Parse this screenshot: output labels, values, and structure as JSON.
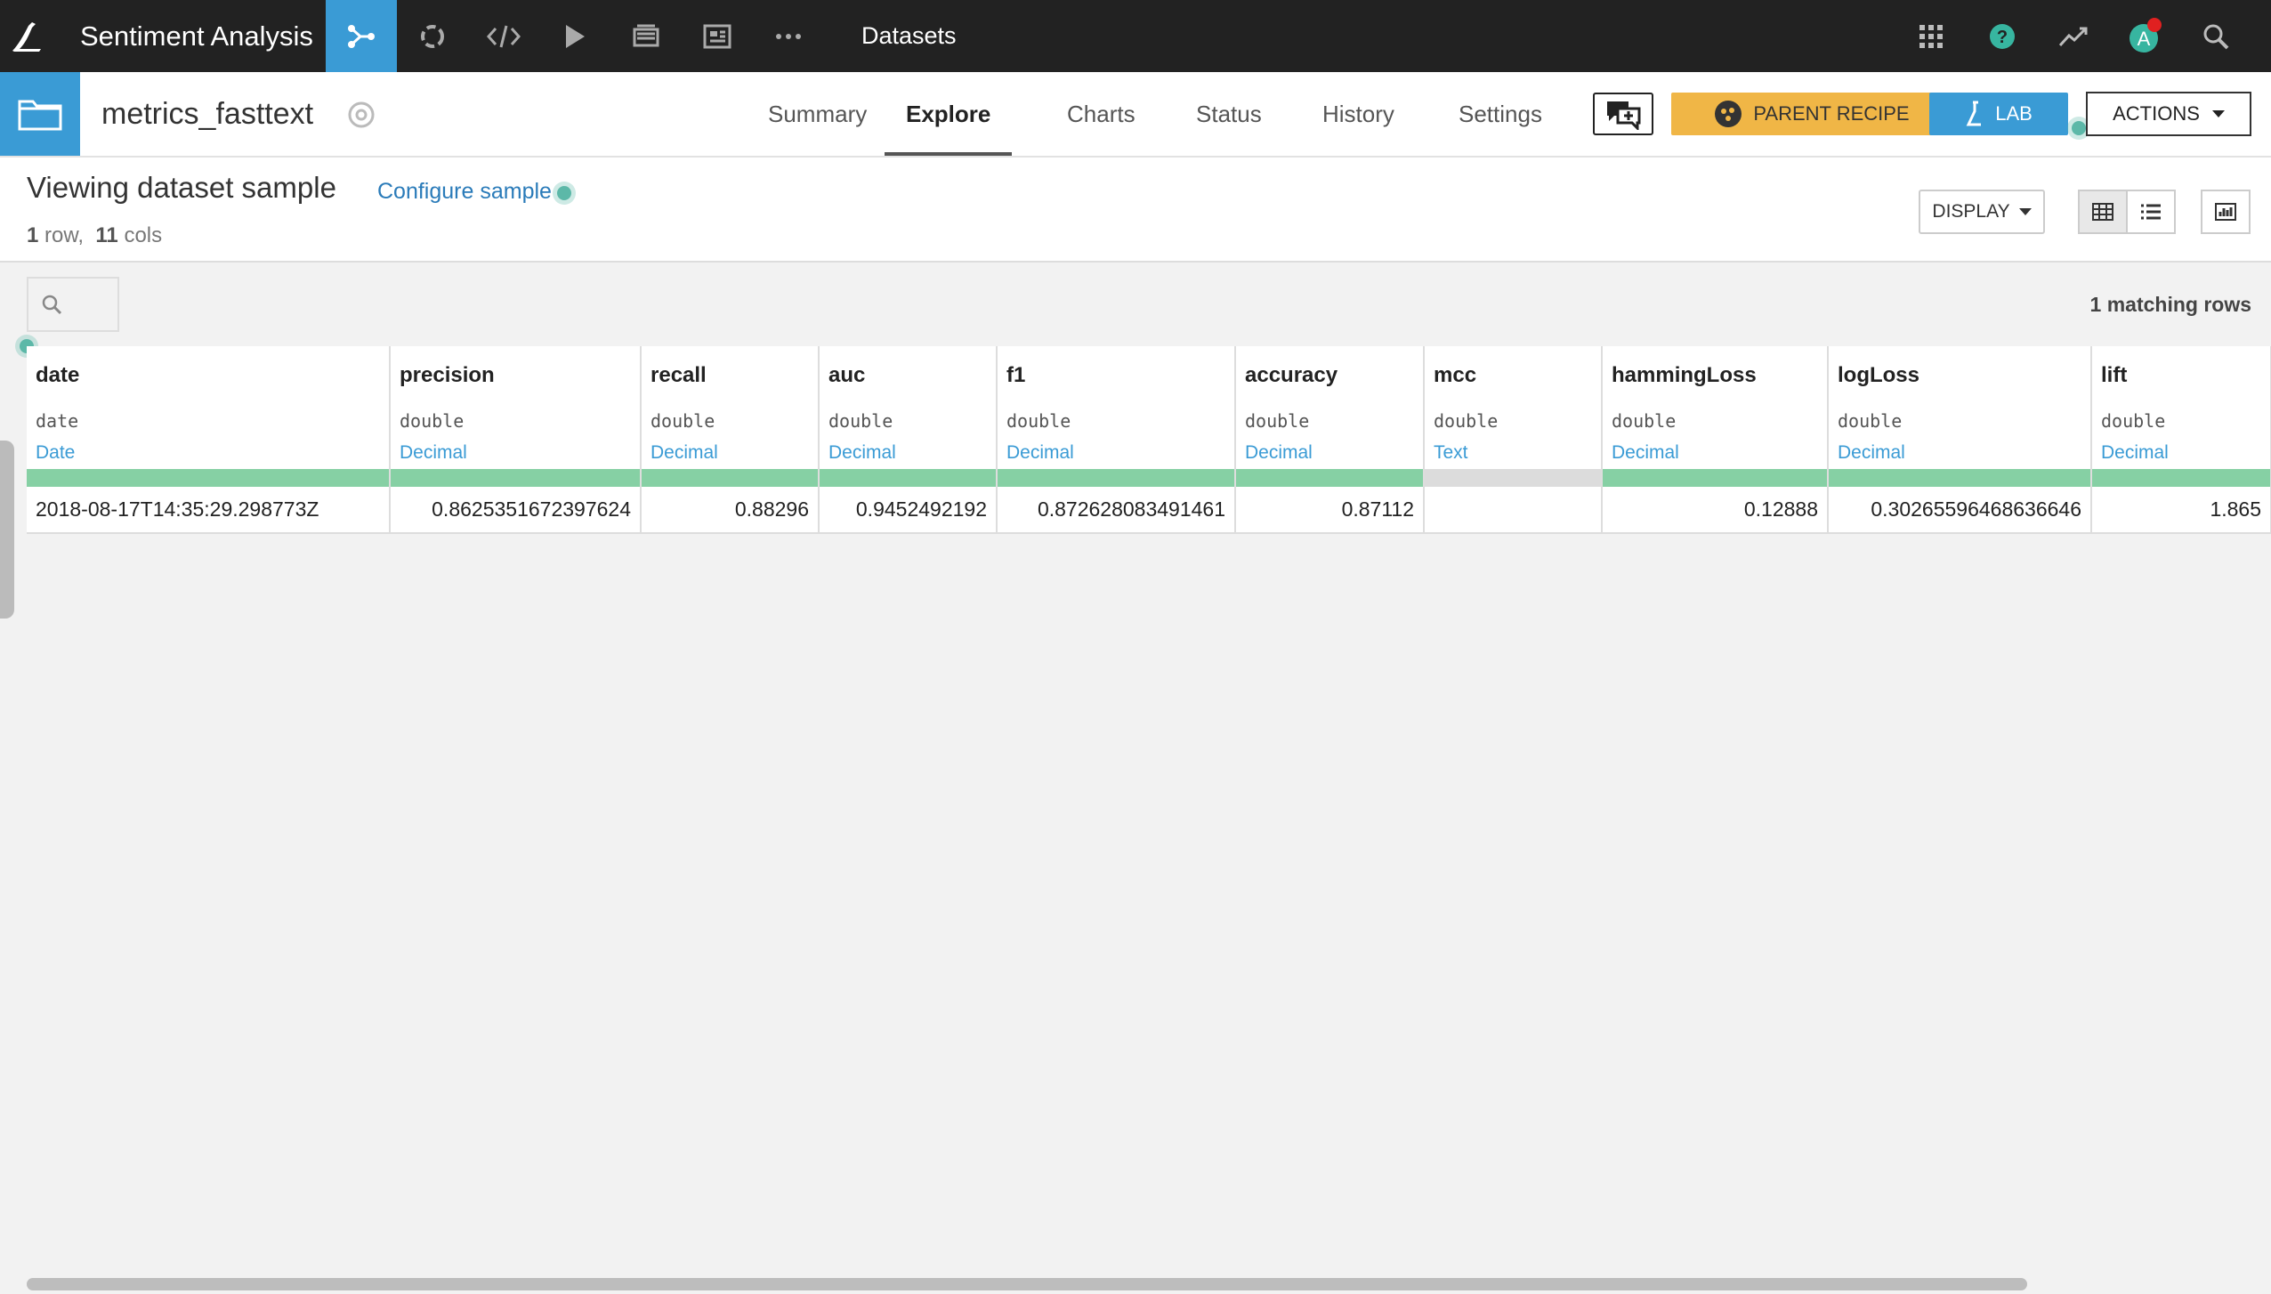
{
  "nav": {
    "project_name": "Sentiment Analysis",
    "section_label": "Datasets",
    "left_icons": [
      "flow-icon",
      "refresh-icon",
      "code-icon",
      "play-icon",
      "notebook-icon",
      "dashboard-icon",
      "more-icon"
    ],
    "right_icons": [
      "apps-grid-icon",
      "help-icon",
      "activity-icon",
      "user-avatar-icon",
      "search-icon"
    ],
    "avatar_letter": "A"
  },
  "header": {
    "dataset_name": "metrics_fasttext",
    "tabs": [
      "Summary",
      "Explore",
      "Charts",
      "Status",
      "History",
      "Settings"
    ],
    "active_tab": "Explore",
    "parent_recipe_label": "PARENT RECIPE",
    "lab_label": "LAB",
    "actions_label": "ACTIONS"
  },
  "sample": {
    "title": "Viewing dataset sample",
    "configure_label": "Configure sample",
    "row_count": "1",
    "row_word": "row,",
    "col_count": "11",
    "col_word": "cols",
    "display_label": "DISPLAY",
    "matching_rows": "1 matching rows"
  },
  "table": {
    "columns": [
      {
        "name": "date",
        "type": "date",
        "meaning": "Date"
      },
      {
        "name": "precision",
        "type": "double",
        "meaning": "Decimal"
      },
      {
        "name": "recall",
        "type": "double",
        "meaning": "Decimal"
      },
      {
        "name": "auc",
        "type": "double",
        "meaning": "Decimal"
      },
      {
        "name": "f1",
        "type": "double",
        "meaning": "Decimal"
      },
      {
        "name": "accuracy",
        "type": "double",
        "meaning": "Decimal"
      },
      {
        "name": "mcc",
        "type": "double",
        "meaning": "Text"
      },
      {
        "name": "hammingLoss",
        "type": "double",
        "meaning": "Decimal"
      },
      {
        "name": "logLoss",
        "type": "double",
        "meaning": "Decimal"
      },
      {
        "name": "lift",
        "type": "double",
        "meaning": "Decimal"
      }
    ],
    "rows": [
      [
        "2018-08-17T14:35:29.298773Z",
        "0.8625351672397624",
        "0.88296",
        "0.9452492192",
        "0.872628083491461",
        "0.87112",
        "",
        "0.12888",
        "0.30265596468636646",
        "1.865"
      ]
    ]
  },
  "colors": {
    "topbar": "#222222",
    "accent_blue": "#3a9bd5",
    "parent_recipe": "#f0b646",
    "valid_bar": "#86d0a4",
    "empty_bar": "#dcdcdc"
  }
}
